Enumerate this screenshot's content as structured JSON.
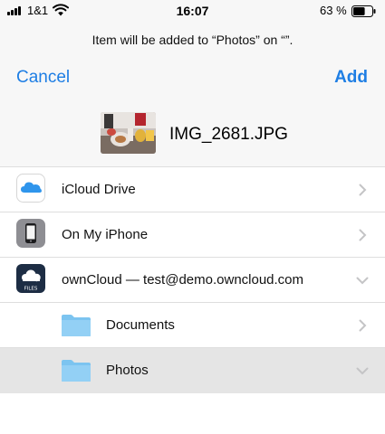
{
  "status_bar": {
    "carrier": "1&1",
    "time": "16:07",
    "battery_percent": "63 %",
    "battery_level": 0.63,
    "icons": [
      "signal-bars-icon",
      "wifi-icon",
      "battery-icon"
    ]
  },
  "header": {
    "destination_note": "Item will be added to “Photos” on “”.",
    "cancel_label": "Cancel",
    "add_label": "Add",
    "accent_color": "#1e7ee4"
  },
  "file": {
    "name": "IMG_2681.JPG",
    "thumbnail_icon": "photo-thumbnail"
  },
  "locations": [
    {
      "label": "iCloud Drive",
      "icon": "icloud-drive-icon",
      "chevron": "right"
    },
    {
      "label": "On My iPhone",
      "icon": "iphone-icon",
      "chevron": "right"
    },
    {
      "label": "ownCloud — test@demo.owncloud.com",
      "icon": "owncloud-icon",
      "icon_caption": "FILES",
      "chevron": "down"
    },
    {
      "label": "Documents",
      "icon": "folder-icon",
      "chevron": "right"
    },
    {
      "label": "Photos",
      "icon": "folder-icon",
      "chevron": "down",
      "selected": true
    }
  ]
}
